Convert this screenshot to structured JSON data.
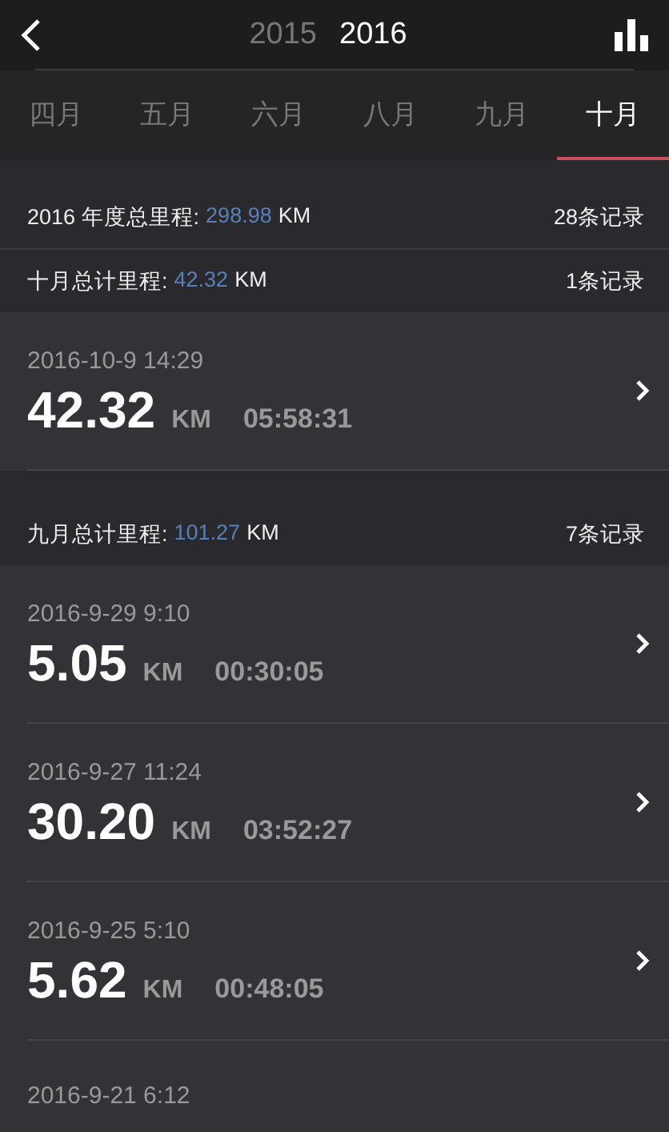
{
  "header": {
    "years": [
      {
        "label": "2015",
        "selected": false
      },
      {
        "label": "2016",
        "selected": true
      }
    ]
  },
  "months": [
    {
      "label": "四月",
      "selected": false
    },
    {
      "label": "五月",
      "selected": false
    },
    {
      "label": "六月",
      "selected": false
    },
    {
      "label": "八月",
      "selected": false
    },
    {
      "label": "九月",
      "selected": false
    },
    {
      "label": "十月",
      "selected": true
    }
  ],
  "year_summary": {
    "label": "2016 年度总里程:",
    "value": "298.98",
    "unit": "KM",
    "count": "28条记录"
  },
  "groups": [
    {
      "summary": {
        "label": "十月总计里程:",
        "value": "42.32",
        "unit": "KM",
        "count": "1条记录"
      },
      "records": [
        {
          "datetime": "2016-10-9 14:29",
          "distance": "42.32",
          "unit": "KM",
          "duration": "05:58:31"
        }
      ]
    },
    {
      "summary": {
        "label": "九月总计里程:",
        "value": "101.27",
        "unit": "KM",
        "count": "7条记录"
      },
      "records": [
        {
          "datetime": "2016-9-29 9:10",
          "distance": "5.05",
          "unit": "KM",
          "duration": "00:30:05"
        },
        {
          "datetime": "2016-9-27 11:24",
          "distance": "30.20",
          "unit": "KM",
          "duration": "03:52:27"
        },
        {
          "datetime": "2016-9-25 5:10",
          "distance": "5.62",
          "unit": "KM",
          "duration": "00:48:05"
        },
        {
          "datetime": "2016-9-21 6:12"
        }
      ]
    }
  ]
}
